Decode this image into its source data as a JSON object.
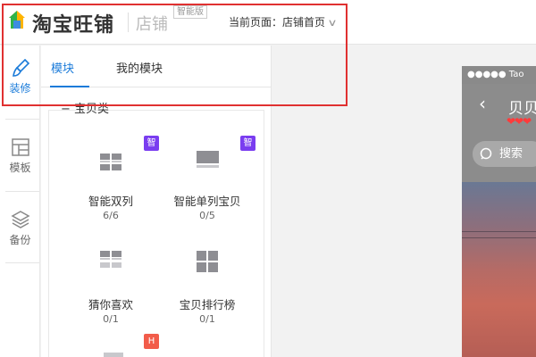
{
  "header": {
    "logo_text": "淘宝旺铺",
    "shop_text": "店铺",
    "edition_badge": "智能版",
    "current_page_label": "当前页面：",
    "current_page_value": "店铺首页"
  },
  "rail": {
    "items": [
      {
        "label": "装修",
        "icon": "brush-icon",
        "active": true
      },
      {
        "label": "模板",
        "icon": "template-icon",
        "active": false
      },
      {
        "label": "备份",
        "icon": "layers-icon",
        "active": false
      }
    ]
  },
  "panel": {
    "tabs": [
      {
        "label": "模块",
        "active": true
      },
      {
        "label": "我的模块",
        "active": false
      }
    ],
    "section_title": "宝贝类",
    "section_toggle": "−",
    "modules": [
      {
        "name": "智能双列",
        "count": "6/6",
        "badge": "智",
        "badge_color": "#7a3df0",
        "icon": "double-column-icon"
      },
      {
        "name": "智能单列宝贝",
        "count": "0/5",
        "badge": "智",
        "badge_color": "#7a3df0",
        "icon": "single-column-icon"
      },
      {
        "name": "猜你喜欢",
        "count": "0/1",
        "badge": "",
        "icon": "guess-like-icon"
      },
      {
        "name": "宝贝排行榜",
        "count": "0/1",
        "badge": "",
        "icon": "ranking-icon"
      }
    ],
    "partial_badge": "H"
  },
  "preview": {
    "status_text": "●●●●● Tao",
    "back_icon": "chevron-left-icon",
    "title": "贝贝",
    "hearts": "❤❤❤",
    "search_placeholder": "搜索"
  },
  "colors": {
    "accent": "#1b7bd9",
    "highlight": "#e03131",
    "smart_badge": "#7a3df0",
    "hot_badge": "#f25c4a"
  }
}
